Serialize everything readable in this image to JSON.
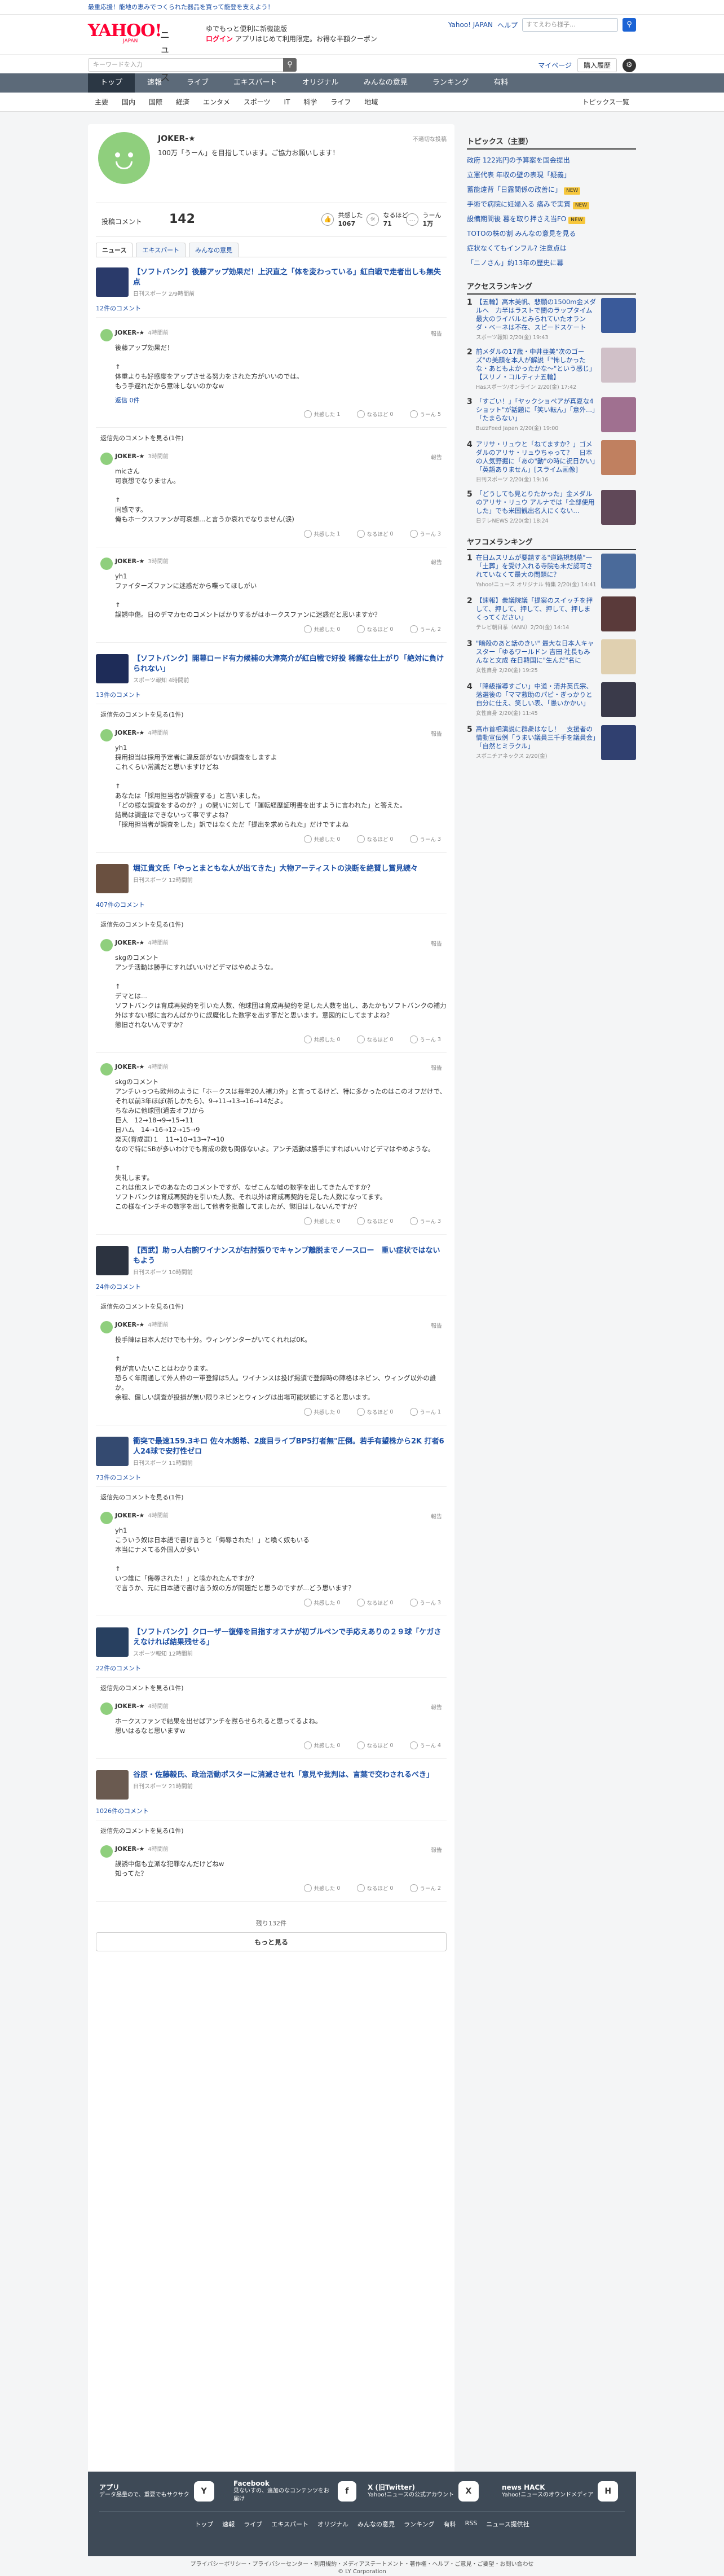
{
  "promo": "最重応援！能地の恵みでつくられた器品を買って能登を支えよう！",
  "header": {
    "logo": "YAHOO!",
    "logo_sub": "JAPAN",
    "section": "ニュース",
    "promo_line1": "ゆでもっと便利に新機能版",
    "promo_login": "ログイン",
    "promo_line2": "アプリはじめて利用限定。お得な半額クーポン",
    "links": [
      "Yahoo! JAPAN",
      "ヘルプ"
    ],
    "search_placeholder": "ウェブ検索",
    "search_sample": "すてえわら様子..."
  },
  "searchrow": {
    "placeholder": "キーワードを入力",
    "mypage": "マイページ",
    "purchase": "購入履歴"
  },
  "nav": [
    "トップ",
    "速報",
    "ライブ",
    "エキスパート",
    "オリジナル",
    "みんなの意見",
    "ランキング",
    "有料"
  ],
  "subnav": [
    "主要",
    "国内",
    "国際",
    "経済",
    "エンタメ",
    "スポーツ",
    "IT",
    "科学",
    "ライフ",
    "地域"
  ],
  "subnav_more": "トピックス一覧",
  "profile": {
    "name": "JOKER-★",
    "intro": "100万「うーん」を目指しています。ご協力お願いします！",
    "report": "不適切な投稿",
    "comment_label": "投稿コメント",
    "comment_count": "142",
    "stats": [
      {
        "label": "共感した",
        "value": "1067",
        "icon": "thumbs-up-icon"
      },
      {
        "label": "なるほど",
        "value": "71",
        "icon": "lightbulb-icon"
      },
      {
        "label": "うーん",
        "value": "1万",
        "icon": "hmm-icon"
      }
    ],
    "tabs": [
      "ニュース",
      "エキスパート",
      "みんなの意見"
    ]
  },
  "articles": [
    {
      "title": "【ソフトバンク】後藤アップ効果だ！上沢直之「体を変わっている」紅白戦で走者出しも無失点",
      "source": "日刊スポーツ 2/9時間前",
      "comments_label": "12件のコメント",
      "thumb_color": "#2a3a6a",
      "comments": [
        {
          "name": "JOKER-★",
          "time": "4時間前",
          "body": "後藤アップ効果だ！\n\n↑\n体重よりも好感度をアップさせる努力をされた方がいいのでは。\nもう手遅れだから意味しないのかなw",
          "reply": "返信 0件",
          "reacts": [
            "1",
            "0",
            "5"
          ],
          "avatar": "green"
        },
        {
          "name": "JOKER-★",
          "time": "3時間前",
          "body": "micさん\n可哀想でなりません。\n\n↑\n同感です。\n俺もホークスファンが可哀想...と言うか哀れでなりません(涙)",
          "reacts": [
            "1",
            "0",
            "3"
          ],
          "avatar": "green",
          "thread": true,
          "reply_label": "返信先のコメントを見る(1件)"
        },
        {
          "name": "JOKER-★",
          "time": "3時間前",
          "body": "yh1\nファイターズファンに迷惑だから喋ってほしがい\n\n↑\n誤誘中傷。日のデマカセのコメントばかりするがはホークスファンに迷惑だと思いますか？",
          "reacts": [
            "0",
            "0",
            "2"
          ],
          "avatar": "green"
        }
      ]
    },
    {
      "title": "【ソフトバンク】開幕ロード有力候補の大津亮介が紅白戦で好投 稀露な仕上がり「絶対に負けられない」",
      "source": "スポーツ報知 4時間前",
      "comments_label": "13件のコメント",
      "thumb_color": "#1e2c58",
      "comments": [
        {
          "name": "JOKER-★",
          "time": "4時間前",
          "body": "yh1\n採用担当は採用予定者に違反部がないか調査をしますよ\nこれくらい常識だと思いますけどね\n\n↑\nあなたは「採用担当者が調査する」と言いました。\n「どの様な調査をするのか？」の問いに対して「運転経歴証明書を出すように言われた」と答えた。\n結局は調査はできないって事ですよね？\n「採用担当者が調査をした」訳ではなくただ「提出を求められた」だけですよね",
          "reacts": [
            "0",
            "0",
            "3"
          ],
          "avatar": "green",
          "thread": true,
          "reply_label": "返信先のコメントを見る(1件)"
        }
      ]
    },
    {
      "title": "堀江貴文氏「やっとまともな人が出てきた」大物アーティストの決断を絶賛し賞見続々",
      "source": "日刊スポーツ 12時間前",
      "comments_label": "407件のコメント",
      "thumb_color": "#6a5040",
      "comments": [
        {
          "name": "JOKER-★",
          "time": "4時間前",
          "body": "skgのコメント\nアンチ活動は勝手にすればいいけどデマはやめような。\n\n↑\nデマとは...\nソフトバンクは育成再契約を引いた人数、他球団は育成再契約を足した人数を出し、あたかもソフトバンクの補力外はすない様に言わんばかりに誤魔化した数字を出す事だと思います。意図的にしてますよね？\n懲旧されないんですか？",
          "reacts": [
            "0",
            "0",
            "3"
          ],
          "avatar": "green",
          "thread": true,
          "reply_label": "返信先のコメントを見る(1件)"
        },
        {
          "name": "JOKER-★",
          "time": "4時間前",
          "body": "skgのコメント\nアンチいっつも欧州のように「ホークスは毎年20人補力外」と言ってるけど、特に多かったのはこのオフだけで、それ以前3年ほぼ(新しかたら)、9→11→13→16→14だよ。\nちなみに他球団(過去オフ)から\n巨人　12→18→9→15→11\n日ハム　14→16→12→15→9\n楽天(育成選)１　11→10→13→7→10\nなので特にSBが多いわけでも育成の数も関係ないよ。アンチ活動は勝手にすればいいけどデマはやめような。\n\n↑\n失礼します。\nこれは他スレでのあなたのコメントですが、なぜこんな嘘の数字を出してきたんですか？\nソフトバンクは育成再契約を引いた人数、それ以外は育成再契約を足した人数になってます。\nこの様なインチキの数字を出して他者を批難してましたが、懲旧はしないんですか？",
          "reacts": [
            "0",
            "0",
            "3"
          ],
          "avatar": "green"
        }
      ]
    },
    {
      "title": "【西武】助っ人右腕ワイナンスが右肘張りでキャンプ離脱までノースロー　重い症状ではないもよう",
      "source": "日刊スポーツ 10時間前",
      "comments_label": "24件のコメント",
      "thumb_color": "#2c3340",
      "comments": [
        {
          "name": "JOKER-★",
          "time": "4時間前",
          "body": "投手陣は日本人だけでも十分。ウィンゲンターがいてくれれば0K。\n\n↑\n何が言いたいことはわかります。\n恐らく年間通して外人枠の一軍登録は5人。ワイナンスは投げ掲須で登録時の陣格はネビン、ウィング以外の誰か。\n余程、健しい調査が投損が無い限りネビンとウィングは出場可能状態にすると思います。",
          "reacts": [
            "0",
            "0",
            "1"
          ],
          "avatar": "green",
          "thread": true,
          "reply_label": "返信先のコメントを見る(1件)"
        }
      ]
    },
    {
      "title": "衝突で最速159.3キロ 佐々木朗希、2度目ライブBP5打者無\"圧倒。若手有望株から2K 打者6人24球で安打性ゼロ",
      "source": "日刊スポーツ 11時間前",
      "comments_label": "73件のコメント",
      "thumb_color": "#344a70",
      "comments": [
        {
          "name": "JOKER-★",
          "time": "4時間前",
          "body": "yh1\nこういう奴は日本語で書け言うと「侮辱された！」と喚く奴もいる\n本当にナメてる外国人が多い\n\n↑\nいつ誰に「侮辱された！」と喚かれたんですか？\nで言うか、元に日本語で書け言う奴の方が問題だと思うのですが...どう思います？",
          "reacts": [
            "0",
            "0",
            "3"
          ],
          "avatar": "green",
          "thread": true,
          "reply_label": "返信先のコメントを見る(1件)"
        }
      ]
    },
    {
      "title": "【ソフトバンク】クローザー復帰を目指すオスナが初ブルペンで手応えありの２９球「ケガさえなければ結果残せる」",
      "source": "スポーツ報知 12時間前",
      "comments_label": "22件のコメント",
      "thumb_color": "#284060",
      "comments": [
        {
          "name": "JOKER-★",
          "time": "4時間前",
          "body": "ホークスファンで結果を出せばアンチを黙らせられると思ってるよね。\n思いはるなと思いますw",
          "reacts": [
            "0",
            "0",
            "4"
          ],
          "avatar": "green",
          "thread": true,
          "reply_label": "返信先のコメントを見る(1件)"
        }
      ]
    },
    {
      "title": "谷原・佐藤毅氏、政治活動ポスターに消滅させれ「意見や批判は、言葉で交わされるべき」",
      "source": "日刊スポーツ 21時間前",
      "comments_label": "1026件のコメント",
      "thumb_color": "#6a5a50",
      "comments": [
        {
          "name": "JOKER-★",
          "time": "4時間前",
          "body": "誤誘中傷も立派な犯罪なんだけどねw\n知ってた？",
          "reacts": [
            "0",
            "0",
            "2"
          ],
          "avatar": "green",
          "thread": true,
          "reply_label": "返信先のコメントを見る(1件)"
        }
      ]
    }
  ],
  "pager": "残り132件",
  "more_button": "もっと見る",
  "side": {
    "topics_title": "トピックス（主要）",
    "topics": [
      {
        "text": "政府 122兆円の予算案を国会提出",
        "tag": ""
      },
      {
        "text": "立憲代表 年収の壁の表現「疑義」",
        "tag": ""
      },
      {
        "text": "蓄能遠背「日露関係の改善に」",
        "tag": "NEW"
      },
      {
        "text": "手術で病院に妊婦入る 痛みで実質",
        "tag": "NEW"
      },
      {
        "text": "設備期間後 暮を取り押さえ当FO",
        "tag": "NEW"
      },
      {
        "text": "TOTOの株の割 みんなの意見を見る",
        "tag": ""
      },
      {
        "text": "症状なくてもインフル? 注意点は",
        "tag": ""
      },
      {
        "text": "「ニノさん」約13年の歴史に幕",
        "tag": ""
      }
    ],
    "access_title": "アクセスランキング",
    "access": [
      {
        "no": "1",
        "title": "【五輪】高木美帆、悲願の1500m金メダルへ　力半はラストで闇のラップタイム　最大のライバルとみられていたオランダ・ベーネは不在、スピードスケート",
        "src": "スポーツ報知 2/20(金) 19:43",
        "color": "#3a5a9a"
      },
      {
        "no": "2",
        "title": "前メダルの17歳・中井亜美\"次のゴーズ\"の美顔を本人が解説「\"怖しかったな・あともよかったかな～\"という感じ」【スリノ・コルティナ五輪】",
        "src": "Hasスポーツ/オンライン 2/20(金) 17:42",
        "color": "#d0c0c8"
      },
      {
        "no": "3",
        "title": "「すごい！」「ヤックショペアが真夏な4ショット\"が話題に「笑い転ん」「意外...」「たまらない」",
        "src": "BuzzFeed Japan 2/20(金) 19:00",
        "color": "#a07090"
      },
      {
        "no": "4",
        "title": "アリサ・リュウと「ねてますか？」ゴメダルのアリサ・リュウちゃって？　日本の人気野掘に「あの\"動\"の時に祝日かい」「英語ありません」[スライム画像]",
        "src": "日刊スポーツ 2/20(金) 19:16",
        "color": "#c08060"
      },
      {
        "no": "5",
        "title": "「どうしても見とりたかった」金メダルのアリサ・リュウ アルナでは「全部使用した」でも米国観出名人にくない…",
        "src": "日テレNEWS 2/20(金) 18:24",
        "color": "#604858"
      }
    ],
    "yafoo_title": "ヤフコメランキング",
    "yafoo": [
      {
        "no": "1",
        "title": "在日ムスリムが要請する\"道路規制墓\"一「土葬」を受け入れる寺院も未だ認可されていなくて最大の問題に？",
        "src": "Yahoo!ニュース オリジナル 特集 2/20(金) 14:41",
        "color": "#4a6a9a"
      },
      {
        "no": "2",
        "title": "【速報】衆議院議「提案のスイッチを押して、押して、押して、押して、押しまくってください」",
        "src": "テレビ朝日系（ANN）2/20(金) 14:14",
        "color": "#5a3a3a"
      },
      {
        "no": "3",
        "title": "\"暗殺のあと話のきい\" 最大な日本人キャスター「ゆるワールドン 吉田 社長もみんなと文成 在日韓国に\"生んだ\"名に",
        "src": "女性自身 2/20(金) 19:25",
        "color": "#e0d0b0"
      },
      {
        "no": "4",
        "title": "「降級指導すごい」中道・清井英氏宗、落選後の「ママ救助のパピ・ぎっかりと自分に仕え、笑しい表、「愚いかかい」",
        "src": "女性自身 2/20(金) 11:45",
        "color": "#3a3a4a"
      },
      {
        "no": "5",
        "title": "高市首相演説に群衆はなし！　支援者の情動宣伝例「うまい議員三千手を議員会」「自然とミラクル」",
        "src": "スポニチアネックス 2/20(金)",
        "color": "#304070"
      }
    ]
  },
  "footer": {
    "apps": [
      {
        "title": "アプリ",
        "desc": "データ品量ので、重要でもサクサク",
        "icon": "app-icon",
        "glyph": "Y"
      },
      {
        "title": "Facebook",
        "desc": "見ないすの、追加のなコンテンツをお届け",
        "icon": "facebook-icon",
        "glyph": "f"
      },
      {
        "title": "X (旧Twitter)",
        "desc": "Yahoo!ニュースの公式アカウント",
        "icon": "x-icon",
        "glyph": "X"
      },
      {
        "title": "news HACK",
        "desc": "Yahoo!ニュースのオウンドメディア",
        "icon": "news-hack-icon",
        "glyph": "H"
      }
    ],
    "links": [
      "トップ",
      "速報",
      "ライブ",
      "エキスパート",
      "オリジナル",
      "みんなの意見",
      "ランキング",
      "有料",
      "RSS",
      "ニュース提供社"
    ],
    "legal1": "プライバシーポリシー・プライバシーセンター・利用規約・メディアステートメント・著作権・ヘルプ・ご意見・ご要望・お問い合わせ",
    "legal2": "© LY Corporation"
  },
  "reaction_labels": [
    "共感した",
    "なるほど",
    "うーん"
  ],
  "report_label": "報告"
}
